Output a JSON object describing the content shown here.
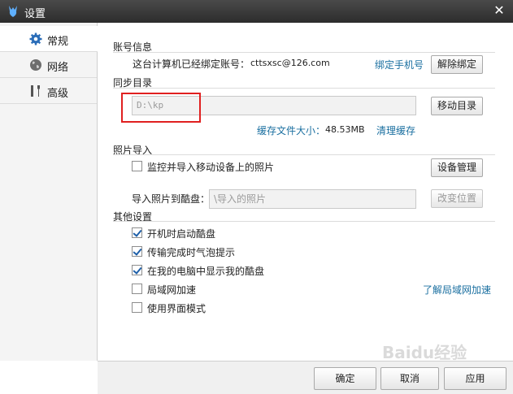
{
  "window": {
    "title": "设置",
    "close_glyph": "✕"
  },
  "sidebar": {
    "items": [
      {
        "label": "常规",
        "icon": "gear-icon",
        "active": true
      },
      {
        "label": "网络",
        "icon": "globe-icon",
        "active": false
      },
      {
        "label": "高级",
        "icon": "tools-icon",
        "active": false
      }
    ]
  },
  "account": {
    "section_title": "账号信息",
    "bound_text": "这台计算机已经绑定账号：",
    "email": "cttsxsc@126.com",
    "bind_phone_link": "绑定手机号",
    "unbind_button": "解除绑定"
  },
  "sync": {
    "section_title": "同步目录",
    "path": "D:\\kp",
    "move_button": "移动目录",
    "cache_size_label": "缓存文件大小：",
    "cache_size_value": "48.53MB",
    "clear_cache_link": "清理缓存"
  },
  "photo": {
    "section_title": "照片导入",
    "monitor_label": "监控并导入移动设备上的照片",
    "monitor_checked": false,
    "device_button": "设备管理",
    "import_to_label": "导入照片到酷盘：",
    "import_path_placeholder": "\\导入的照片",
    "change_location_button": "改变位置"
  },
  "other": {
    "section_title": "其他设置",
    "options": [
      {
        "label": "开机时启动酷盘",
        "checked": true
      },
      {
        "label": "传输完成时气泡提示",
        "checked": true
      },
      {
        "label": "在我的电脑中显示我的酷盘",
        "checked": true
      },
      {
        "label": "局域网加速",
        "checked": false
      },
      {
        "label": "使用界面模式",
        "checked": false
      }
    ],
    "lan_link": "了解局域网加速"
  },
  "footer": {
    "ok": "确定",
    "cancel": "取消",
    "apply": "应用"
  },
  "watermark": "Baidu经验",
  "colors": {
    "titlebar": "#3a3a3a",
    "link": "#1a6fa0",
    "highlight_box": "#e02020",
    "checkbox_check": "#1e5fa8"
  }
}
